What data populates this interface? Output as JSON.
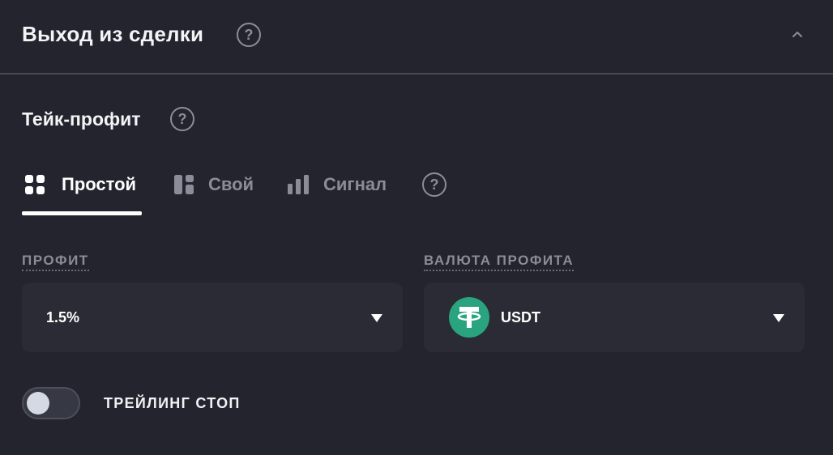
{
  "header": {
    "title": "Выход из сделки",
    "help_icon": "question-circle-icon",
    "collapse_icon": "chevron-up-icon"
  },
  "take_profit": {
    "title": "Тейк-профит",
    "help_icon": "question-circle-icon",
    "tabs": [
      {
        "label": "Простой",
        "icon": "grid-four-icon",
        "active": true
      },
      {
        "label": "Свой",
        "icon": "layout-blocks-icon",
        "active": false
      },
      {
        "label": "Сигнал",
        "icon": "bar-chart-icon",
        "active": false
      }
    ],
    "tabs_help_icon": "question-circle-icon"
  },
  "profit": {
    "label": "ПРОФИТ",
    "value": "1.5%",
    "dropdown_icon": "caret-down-icon"
  },
  "currency": {
    "label": "ВАЛЮТА ПРОФИТА",
    "value": "USDT",
    "coin_icon": "tether-icon",
    "dropdown_icon": "caret-down-icon"
  },
  "trailing_stop": {
    "label": "ТРЕЙЛИНГ СТОП",
    "enabled": false
  },
  "colors": {
    "background": "#23242d",
    "field_background": "#2a2b34",
    "muted_text": "#8a8d97",
    "tether_green": "#2aa47f"
  }
}
